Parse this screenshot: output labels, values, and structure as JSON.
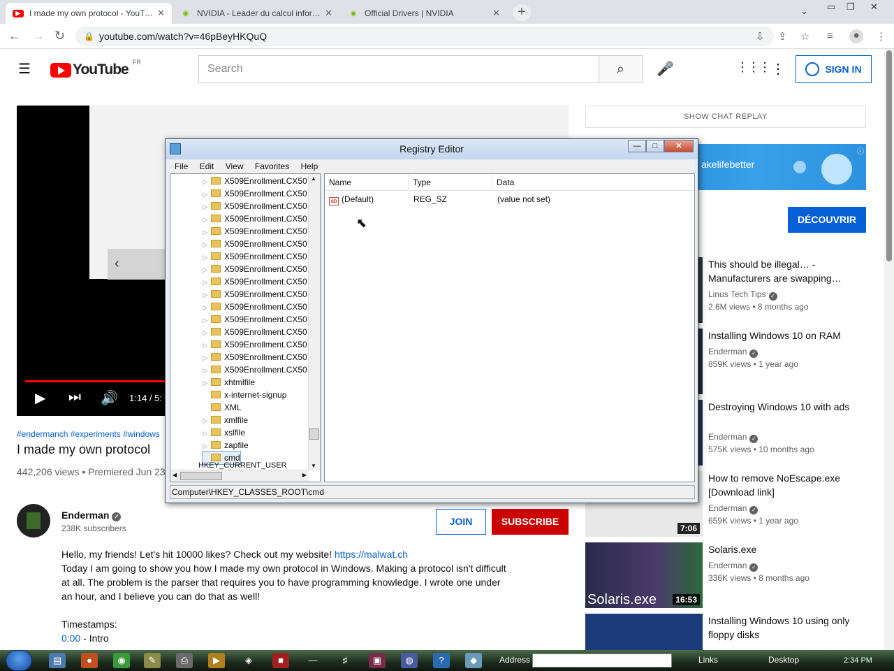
{
  "browser": {
    "tabs": [
      {
        "title": "I made my own protocol - YouTube",
        "favicon": "youtube-icon"
      },
      {
        "title": "NVIDIA - Leader du calcul informatique",
        "favicon": "nvidia-icon"
      },
      {
        "title": "Official Drivers | NVIDIA",
        "favicon": "nvidia-icon"
      }
    ],
    "url": "youtube.com/watch?v=46pBeyHKQuQ",
    "new_tab": "+"
  },
  "youtube": {
    "logo": "YouTube",
    "region": "FR",
    "search_placeholder": "Search",
    "sign_in": "SIGN IN",
    "player": {
      "time": "1:14 / 5:"
    },
    "video": {
      "hashtags": "#endermanch #experiments #windows",
      "title": "I made my own protocol",
      "views": "442,206 views • Premiered Jun 23"
    },
    "channel": {
      "name": "Enderman",
      "subscribers": "238K subscribers"
    },
    "join": "JOIN",
    "subscribe": "SUBSCRIBE",
    "description": {
      "line1": "Hello, my friends! Let's hit 10000 likes? Check out my website! ",
      "link": "https://malwat.ch",
      "line2": "Today I am going to show you how I made my own protocol in Windows. Making a protocol isn't difficult at all. The problem is the parser that requires you to have programming knowledge. I wrote one under an hour, and I believe you can do that as well!",
      "timestamps_label": "Timestamps:",
      "ts_time": "0:00",
      "ts_label": " - Intro"
    },
    "chat_replay": "SHOW CHAT REPLAY",
    "ad": {
      "text": "akelifebetter",
      "cta": "DÉCOUVRIR"
    },
    "related": [
      {
        "title": "This should be illegal… - Manufacturers are swapping…",
        "channel": "Linus Tech Tips",
        "meta": "2.6M views • 8 months ago",
        "duration": ""
      },
      {
        "title": "Installing Windows 10 on RAM",
        "channel": "Enderman",
        "meta": "859K views • 1 year ago",
        "duration": ""
      },
      {
        "title": "Destroying Windows 10 with ads",
        "channel": "Enderman",
        "meta": "575K views • 10 months ago",
        "duration": ""
      },
      {
        "title": "How to remove NoEscape.exe [Download link]",
        "channel": "Enderman",
        "meta": "659K views • 1 year ago",
        "duration": "7:06"
      },
      {
        "title": "Solaris.exe",
        "channel": "Enderman",
        "meta": "336K views • 8 months ago",
        "duration": "16:53",
        "thumb_text": "Solaris.exe"
      },
      {
        "title": "Installing Windows 10 using only floppy disks",
        "channel": "",
        "meta": "",
        "duration": ""
      }
    ]
  },
  "registry": {
    "title": "Registry Editor",
    "menu": [
      "File",
      "Edit",
      "View",
      "Favorites",
      "Help"
    ],
    "tree": [
      "X509Enrollment.CX50",
      "X509Enrollment.CX50",
      "X509Enrollment.CX50",
      "X509Enrollment.CX50",
      "X509Enrollment.CX50",
      "X509Enrollment.CX50",
      "X509Enrollment.CX50",
      "X509Enrollment.CX50",
      "X509Enrollment.CX50",
      "X509Enrollment.CX50",
      "X509Enrollment.CX50",
      "X509Enrollment.CX50",
      "X509Enrollment.CX50",
      "X509Enrollment.CX50",
      "X509Enrollment.CX50",
      "X509Enrollment.CX50",
      "xhtmlfile",
      "x-internet-signup",
      "XML",
      "xmlfile",
      "xslfile",
      "zapfile",
      "cmd"
    ],
    "tree_cut": "HKEY_CURRENT_USER",
    "columns": [
      "Name",
      "Type",
      "Data"
    ],
    "values": [
      {
        "name": "(Default)",
        "type": "REG_SZ",
        "data": "(value not set)"
      }
    ],
    "status": "Computer\\HKEY_CLASSES_ROOT\\cmd"
  },
  "taskbar": {
    "address_label": "Address",
    "links": "Links",
    "desktop": "Desktop",
    "clock": "2:34 PM"
  },
  "colors": {
    "yt_red": "#ff0000",
    "yt_blue": "#065fd4",
    "subscribe_red": "#cc0000"
  }
}
